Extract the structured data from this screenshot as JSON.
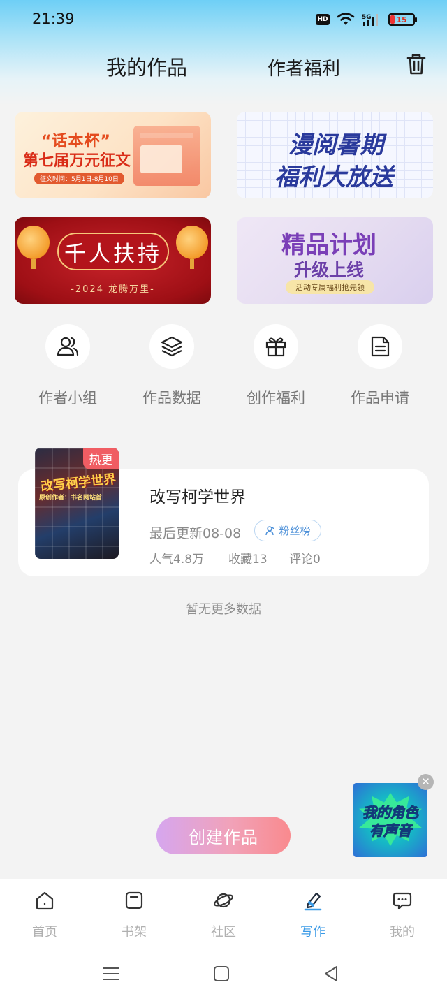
{
  "status_bar": {
    "time": "21:39",
    "network": "5G",
    "hd": "HD",
    "battery": "15"
  },
  "header": {
    "tab_works": "我的作品",
    "tab_benefits": "作者福利"
  },
  "banners": {
    "b1": {
      "line1": "“话本杯”",
      "line2": "第七届万元征文",
      "line3": "征文时间：5月1日-8月10日"
    },
    "b2": {
      "line1": "漫阅暑期",
      "line2": "福利大放送"
    },
    "b3": {
      "line1": "千人扶持",
      "line2": "-2024 龙腾万里-"
    },
    "b4": {
      "line1": "精品计划",
      "line2": "升级上线",
      "line3": "活动专属福利抢先领"
    }
  },
  "actions": [
    {
      "label": "作者小组",
      "icon": "group-icon"
    },
    {
      "label": "作品数据",
      "icon": "layers-icon"
    },
    {
      "label": "创作福利",
      "icon": "gift-icon"
    },
    {
      "label": "作品申请",
      "icon": "document-icon"
    }
  ],
  "work": {
    "badge": "热更",
    "cover_title": "改写柯学世界",
    "cover_sub": "原创作者：书名网站首",
    "title": "改写柯学世界",
    "updated": "最后更新08-08",
    "fan_rank": "粉丝榜",
    "popularity": "人气4.8万",
    "favorites": "收藏13",
    "comments": "评论0"
  },
  "no_more": "暂无更多数据",
  "promo": {
    "line1": "我的角色",
    "line2": "有声音"
  },
  "create_button": "创建作品",
  "bottom_nav": [
    {
      "label": "首页",
      "icon": "home-icon",
      "active": false
    },
    {
      "label": "书架",
      "icon": "bookshelf-icon",
      "active": false
    },
    {
      "label": "社区",
      "icon": "planet-icon",
      "active": false
    },
    {
      "label": "写作",
      "icon": "pen-icon",
      "active": true
    },
    {
      "label": "我的",
      "icon": "chat-bubble-icon",
      "active": false
    }
  ],
  "colors": {
    "accent": "#3a9ae6",
    "hot": "#f05d63",
    "header_gradient": "#6ecff6"
  }
}
